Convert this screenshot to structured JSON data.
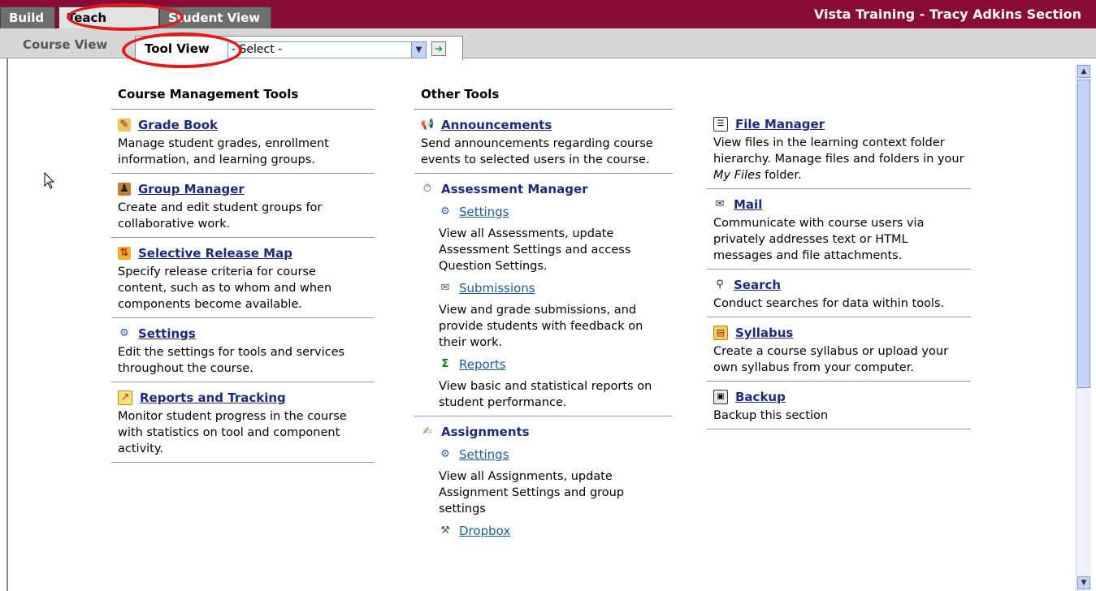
{
  "tabs": {
    "build": "Build",
    "teach": "Teach",
    "student_view": "Student View"
  },
  "section_title": "Vista Training - Tracy Adkins Section",
  "subbar": {
    "course_view": "Course View",
    "tool_view": "Tool View",
    "select_value": "- Select -"
  },
  "columns": {
    "course_management": {
      "heading": "Course Management Tools",
      "items": [
        {
          "icon": "grade-book-icon",
          "label": "Grade Book",
          "desc": "Manage student grades, enrollment information, and learning groups."
        },
        {
          "icon": "group-manager-icon",
          "label": "Group Manager",
          "desc": "Create and edit student groups for collaborative work."
        },
        {
          "icon": "selective-release-icon",
          "label": "Selective Release Map",
          "desc": "Specify release criteria for course content, such as to whom and when components become available."
        },
        {
          "icon": "settings-icon",
          "label": "Settings",
          "desc": "Edit the settings for tools and services throughout the course."
        },
        {
          "icon": "reports-tracking-icon",
          "label": "Reports and Tracking",
          "desc": "Monitor student progress in the course with statistics on tool and component activity."
        }
      ]
    },
    "other_tools": {
      "heading": "Other Tools",
      "announcements": {
        "label": "Announcements",
        "desc": "Send announcements regarding course events to selected users in the course."
      },
      "assessment_manager": {
        "label": "Assessment Manager",
        "subs": [
          {
            "label": "Settings",
            "desc": "View all Assessments, update Assessment Settings and access Question Settings."
          },
          {
            "label": "Submissions",
            "desc": "View and grade submissions, and provide students with feedback on their work."
          },
          {
            "label": "Reports",
            "desc": "View basic and statistical reports on student performance."
          }
        ]
      },
      "assignments": {
        "label": "Assignments",
        "subs": [
          {
            "label": "Settings",
            "desc": "View all Assignments, update Assignment Settings and group settings"
          },
          {
            "label": "Dropbox",
            "desc": ""
          }
        ]
      }
    },
    "third": {
      "items": [
        {
          "label": "File Manager",
          "desc_a": "View files in the learning context folder hierarchy. Manage files and folders in your ",
          "desc_em": "My Files",
          "desc_b": " folder."
        },
        {
          "label": "Mail",
          "desc": "Communicate with course users via privately addresses text or HTML messages and file attachments."
        },
        {
          "label": "Search",
          "desc": "Conduct searches for data within tools."
        },
        {
          "label": "Syllabus",
          "desc": "Create a course syllabus or upload your own syllabus from your computer."
        },
        {
          "label": "Backup",
          "desc": "Backup this section"
        }
      ]
    }
  },
  "colors": {
    "header_bar": "#8a0c36",
    "link": "#1c2b7e",
    "highlight_circle": "#e31a1a"
  }
}
